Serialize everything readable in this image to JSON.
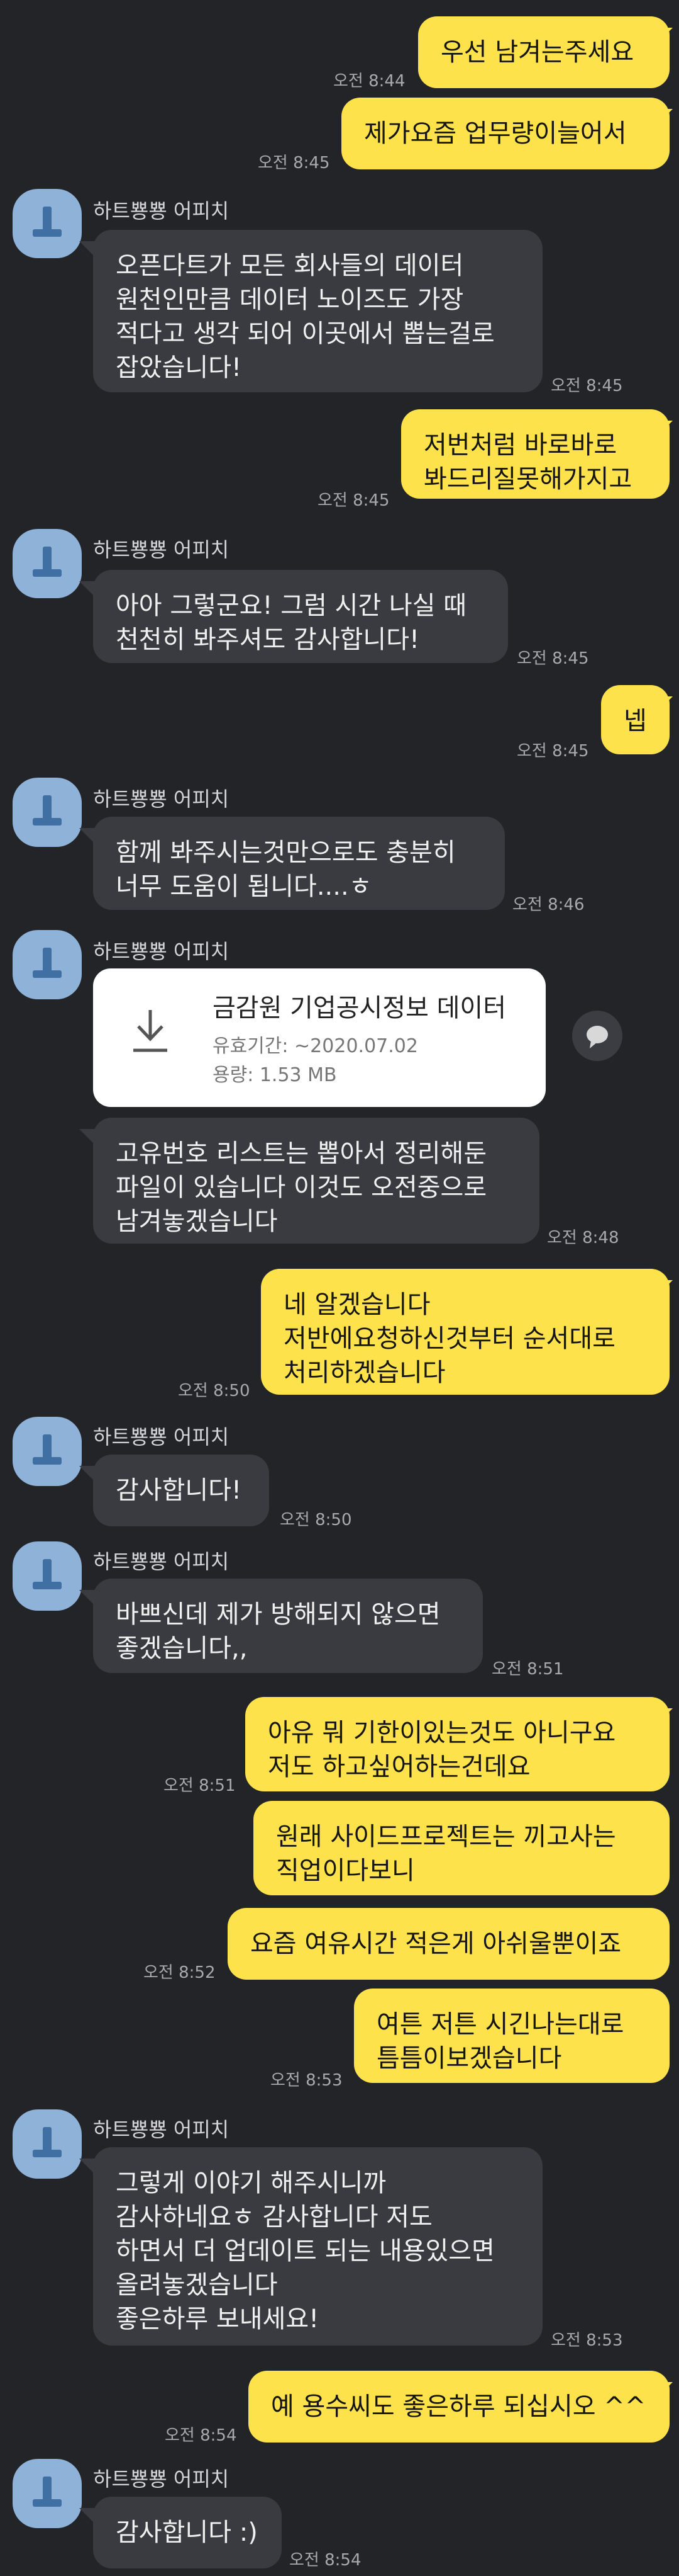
{
  "sender_name": "하트뿅뿅 어피치",
  "colors": {
    "background": "#232428",
    "outgoing_bubble": "#fde24b",
    "incoming_bubble": "#3a3b40",
    "avatar": "#8fb2d9"
  },
  "messages": [
    {
      "id": "m1",
      "dir": "out",
      "text": "우선 남겨는주세요",
      "time": "오전 8:44"
    },
    {
      "id": "m2",
      "dir": "out",
      "text": "제가요즘 업무량이늘어서",
      "time": "오전 8:45"
    },
    {
      "id": "m3",
      "dir": "in",
      "text": "오픈다트가 모든 회사들의 데이터\n원천인만큼 데이터 노이즈도 가장\n적다고 생각 되어 이곳에서 뽑는걸로\n잡았습니다!",
      "time": "오전 8:45"
    },
    {
      "id": "m4",
      "dir": "out",
      "text": "저번처럼 바로바로\n봐드리질못해가지고",
      "time": "오전 8:45"
    },
    {
      "id": "m5",
      "dir": "in",
      "text": "아아 그렇군요! 그럼 시간 나실 때\n천천히 봐주셔도 감사합니다!",
      "time": "오전 8:45"
    },
    {
      "id": "m6",
      "dir": "out",
      "text": "넵",
      "time": "오전 8:45"
    },
    {
      "id": "m7",
      "dir": "in",
      "text": "함께 봐주시는것만으로도 충분히\n너무 도움이 됩니다....ㅎ",
      "time": "오전 8:46"
    },
    {
      "id": "m8",
      "dir": "file",
      "file": {
        "name": "금감원 기업공시정보 데이터",
        "expiry": "유효기간: ~2020.07.02",
        "size": "용량: 1.53 MB"
      }
    },
    {
      "id": "m9",
      "dir": "in",
      "text": "고유번호 리스트는 뽑아서 정리해둔\n파일이 있습니다 이것도 오전중으로\n남겨놓겠습니다",
      "time": "오전 8:48"
    },
    {
      "id": "m10",
      "dir": "out",
      "text": "네 알겠습니다\n저반에요청하신것부터 순서대로\n처리하겠습니다",
      "time": "오전 8:50"
    },
    {
      "id": "m11",
      "dir": "in",
      "text": "감사합니다!",
      "time": "오전 8:50"
    },
    {
      "id": "m12",
      "dir": "in",
      "text": "바쁘신데 제가 방해되지 않으면\n좋겠습니다,,",
      "time": "오전 8:51"
    },
    {
      "id": "m13",
      "dir": "out",
      "text": "아유 뭐 기한이있는것도 아니구요\n저도 하고싶어하는건데요",
      "time": "오전 8:51"
    },
    {
      "id": "m14",
      "dir": "out",
      "text": "원래 사이드프로젝트는 끼고사는\n직업이다보니",
      "time": ""
    },
    {
      "id": "m15",
      "dir": "out",
      "text": "요즘 여유시간 적은게 아쉬울뿐이죠",
      "time": "오전 8:52"
    },
    {
      "id": "m16",
      "dir": "out",
      "text": "여튼 저튼 시긴나는대로\n틈틈이보겠습니다",
      "time": "오전 8:53"
    },
    {
      "id": "m17",
      "dir": "in",
      "text": "그렇게 이야기 해주시니까\n감사하네요ㅎ 감사합니다 저도\n하면서 더 업데이트 되는 내용있으면\n올려놓겠습니다\n좋은하루 보내세요!",
      "time": "오전 8:53"
    },
    {
      "id": "m18",
      "dir": "out",
      "text": "예 용수씨도 좋은하루 되십시오 ^^",
      "time": "오전 8:54"
    },
    {
      "id": "m19",
      "dir": "in",
      "text": "감사합니다 :)",
      "time": "오전 8:54"
    }
  ]
}
